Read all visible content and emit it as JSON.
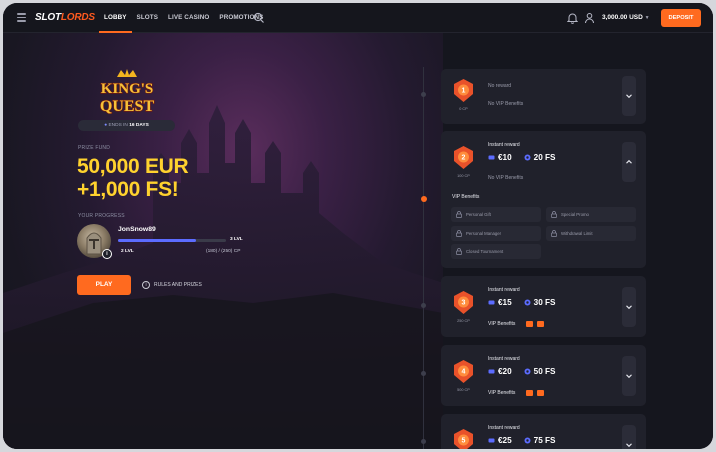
{
  "header": {
    "logo_part1": "SLOT",
    "logo_part2": "LORDS",
    "nav": [
      "LOBBY",
      "SLOTS",
      "LIVE CASINO",
      "PROMOTIONS"
    ],
    "balance": "3,000.00 USD",
    "deposit_label": "DEPOSIT"
  },
  "promo": {
    "logo_line1": "KING'S",
    "logo_line2": "QUEST",
    "ends_label": "ENDS IN",
    "ends_value": "16 DAYS",
    "prize_label": "PRIZE FUND",
    "prize_line1": "50,000 EUR",
    "prize_line2": "+1,000 FS!",
    "progress_label": "YOUR PROGRESS",
    "username": "JonSnow89",
    "level_current": "2 LVL",
    "level_next": "3 LVL",
    "cp_progress": "(180) / (250) CP",
    "progress_fraction": 0.72,
    "play_label": "PLAY",
    "rules_label": "RULES AND PRIZES"
  },
  "levels": [
    {
      "num": "1",
      "cp": "0 CP",
      "reward": "No reward",
      "vip": "No VIP Benefits"
    },
    {
      "num": "2",
      "cp": "100 CP",
      "reward_label": "Instant reward",
      "cash": "€10",
      "fs": "20 FS",
      "vip": "No VIP Benefits",
      "vip_title": "VIP Benefits",
      "vip_items": [
        "Personal Gift",
        "Special Promo",
        "Personal Manager",
        "Withdrawal Limit",
        "Closed Tournament"
      ]
    },
    {
      "num": "3",
      "cp": "250 CP",
      "reward_label": "Instant reward",
      "cash": "€15",
      "fs": "30 FS",
      "vip": "VIP Benefits"
    },
    {
      "num": "4",
      "cp": "500 CP",
      "reward_label": "Instant reward",
      "cash": "€20",
      "fs": "50 FS",
      "vip": "VIP Benefits"
    },
    {
      "num": "5",
      "reward_label": "Instant reward",
      "cash": "€25",
      "fs": "75 FS"
    }
  ],
  "colors": {
    "accent": "#ff6a1f",
    "gold": "#ffd22e",
    "progress": "#5c6cff"
  }
}
